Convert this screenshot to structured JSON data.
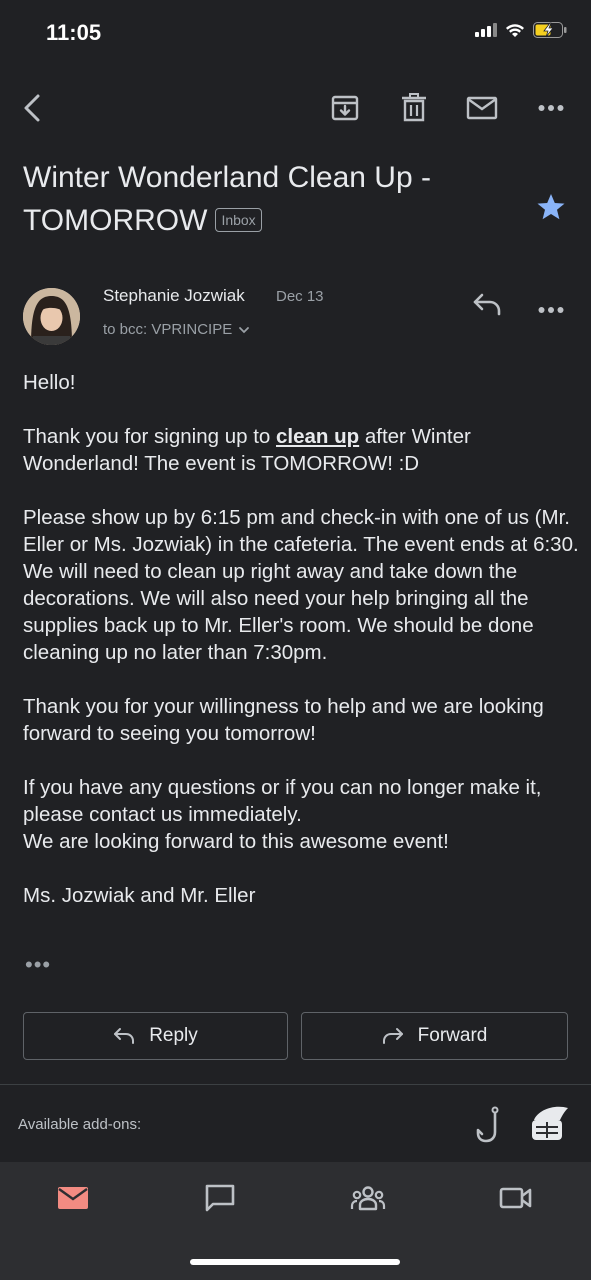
{
  "status_bar": {
    "time": "11:05",
    "icons": [
      "signal-icon",
      "wifi-icon",
      "battery-charging-icon"
    ]
  },
  "toolbar": {
    "icons": [
      "back-icon",
      "archive-icon",
      "delete-icon",
      "mark-unread-icon",
      "more-icon"
    ]
  },
  "email": {
    "subject": "Winter Wonderland Clean Up - TOMORROW",
    "label": "Inbox",
    "starred": true,
    "sender": {
      "name": "Stephanie Jozwiak",
      "date": "Dec 13",
      "recipients": "to bcc: VPRINCIPE"
    },
    "body": {
      "greeting": "Hello!",
      "p1_before": "Thank you for signing up to ",
      "p1_link": "clean up",
      "p1_after": " after Winter Wonderland!  The event is TOMORROW! :D",
      "p2": "Please show up by 6:15 pm and check-in with one of us (Mr. Eller or Ms. Jozwiak) in the cafeteria.   The event ends at 6:30.  We will need to clean up right away and take down the decorations.  We will also need your help bringing all the supplies back up to Mr. Eller's room.  We should be done cleaning up no later than 7:30pm.",
      "p3": "Thank you for your willingness to help and we are looking forward to seeing you tomorrow!",
      "p4a": "If you have any questions or if you can no longer make it, please contact us immediately.",
      "p4b": "We are looking forward to this awesome event!",
      "signature": "Ms. Jozwiak and Mr. Eller",
      "trimmed": "•••"
    }
  },
  "actions": {
    "reply_label": "Reply",
    "forward_label": "Forward"
  },
  "addons": {
    "label": "Available add-ons:",
    "icons": [
      "hook-addon-icon",
      "notes-addon-icon"
    ]
  },
  "bottom_nav": {
    "items": [
      "mail-icon",
      "chat-icon",
      "spaces-icon",
      "meet-icon"
    ],
    "active": "mail-icon",
    "active_color": "#f28b82"
  },
  "colors": {
    "background": "#202124",
    "star": "#8ab4f8",
    "muted_text": "#9aa0a6"
  }
}
